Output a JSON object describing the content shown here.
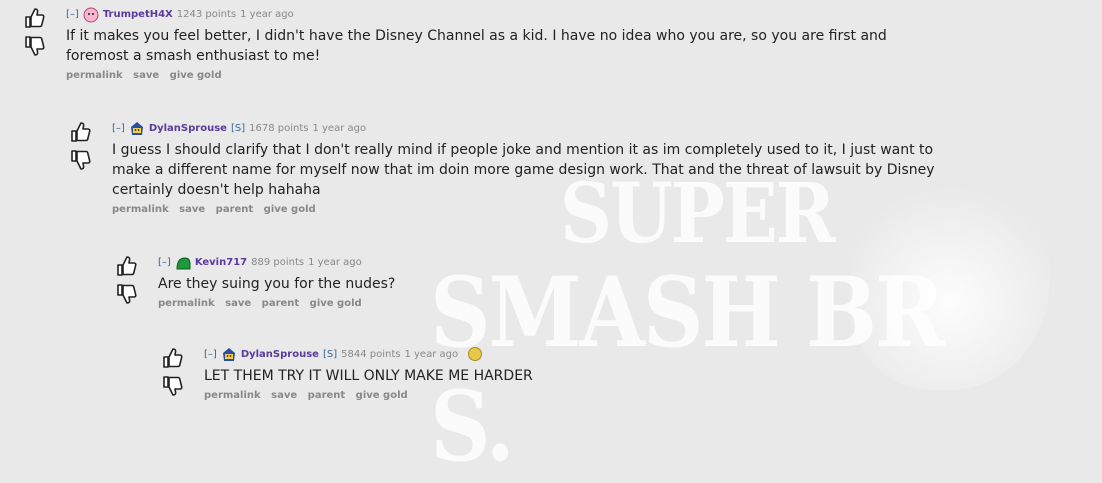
{
  "comments": [
    {
      "toggle": "[–]",
      "author": "TrumpetH4X",
      "flair_icon": "pink-puffball-icon",
      "score": "1243 points",
      "time": "1 year ago",
      "lines": [
        "If it makes you feel better, I didn't have the Disney Channel as a kid. I have no idea who you are, so you are first and",
        "foremost a smash enthusiast to me!"
      ],
      "actions": [
        "permalink",
        "save",
        "give gold"
      ]
    },
    {
      "toggle": "[–]",
      "author": "DylanSprouse",
      "flair_icon": "blue-character-icon",
      "submitter": "[S]",
      "score": "1678 points",
      "time": "1 year ago",
      "lines": [
        "I guess I should clarify that I don't really mind if people joke and mention it as im completely used to it, I just want to",
        "make a different name for myself now that im doin more game design work. That and the threat of lawsuit by Disney",
        "certainly doesn't help hahaha"
      ],
      "actions": [
        "permalink",
        "save",
        "parent",
        "give gold"
      ]
    },
    {
      "toggle": "[–]",
      "author": "Kevin717",
      "flair_icon": "green-shell-icon",
      "score": "889 points",
      "time": "1 year ago",
      "lines": [
        "Are they suing you for the nudes?"
      ],
      "actions": [
        "permalink",
        "save",
        "parent",
        "give gold"
      ]
    },
    {
      "toggle": "[–]",
      "author": "DylanSprouse",
      "flair_icon": "blue-character-icon",
      "submitter": "[S]",
      "score": "5844 points",
      "time": "1 year ago",
      "gilded_icon": "gold-star-icon",
      "lines": [
        "LET THEM TRY IT WILL ONLY MAKE ME HARDER"
      ],
      "actions": [
        "permalink",
        "save",
        "parent",
        "give gold"
      ]
    }
  ],
  "background": {
    "line1": "SUPER",
    "line2": "SMASH BR S."
  },
  "colors": {
    "author": "#5a3b9a",
    "link": "#336699",
    "meta": "#888888",
    "background": "#e9e9e9"
  }
}
